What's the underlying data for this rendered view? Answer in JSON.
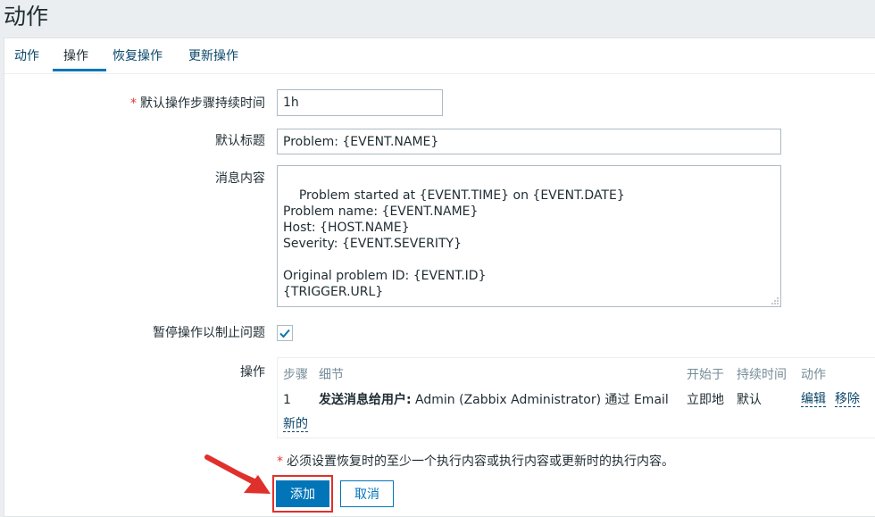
{
  "page": {
    "title": "动作"
  },
  "tabs": [
    {
      "label": "动作"
    },
    {
      "label": "操作"
    },
    {
      "label": "恢复操作"
    },
    {
      "label": "更新操作"
    }
  ],
  "form": {
    "required_mark": "*",
    "default_step_duration": {
      "label": "默认操作步骤持续时间",
      "value": "1h"
    },
    "default_subject": {
      "label": "默认标题",
      "value": "Problem: {EVENT.NAME}"
    },
    "default_message": {
      "label": "消息内容",
      "value": "Problem started at {EVENT.TIME} on {EVENT.DATE}\nProblem name: {EVENT.NAME}\nHost: {HOST.NAME}\nSeverity: {EVENT.SEVERITY}\n\nOriginal problem ID: {EVENT.ID}\n{TRIGGER.URL}"
    },
    "pause_suppressed": {
      "label": "暂停操作以制止问题",
      "checked": true
    },
    "operations": {
      "label": "操作",
      "headers": {
        "step": "步骤",
        "details": "细节",
        "start_in": "开始于",
        "duration": "持续时间",
        "action": "动作"
      },
      "rows": [
        {
          "step": "1",
          "details_bold": "发送消息给用户:",
          "details_rest": " Admin (Zabbix Administrator) 通过 Email",
          "start_in": "立即地",
          "duration": "默认",
          "edit": "编辑",
          "remove": "移除"
        }
      ],
      "new_link": "新的"
    },
    "warning": {
      "mark": "*",
      "text": "必须设置恢复时的至少一个执行内容或执行内容或更新时的执行内容。"
    }
  },
  "buttons": {
    "add": "添加",
    "cancel": "取消"
  },
  "colors": {
    "accent": "#0275b8",
    "highlight": "#e0302c",
    "required": "#e33734"
  },
  "icons": {
    "checkbox": "checkmark-icon",
    "arrow": "red-arrow-annotation",
    "grip": "resize-grip-icon"
  }
}
